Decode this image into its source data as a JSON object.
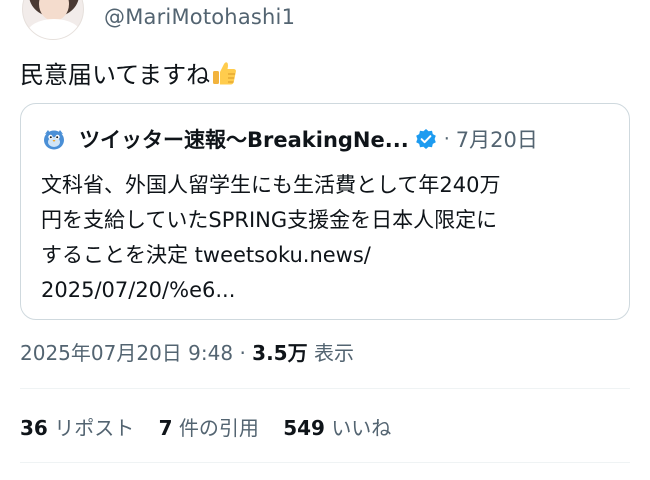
{
  "author": {
    "handle": "@MariMotohashi1"
  },
  "tweet": {
    "text": "民意届いてますね",
    "emoji": "thumbs-up-emoji"
  },
  "quote": {
    "name": "ツイッター速報〜BreakingNe...",
    "separator": "·",
    "date": "7月20日",
    "body_lines": [
      "文科省、外国人留学生にも生活費として年240万",
      "円を支給していたSPRING支援金を日本人限定に",
      "することを決定 tweetsoku.news/",
      "2025/07/20/%e6..."
    ],
    "verified_color": "#1d9bf0",
    "icon": "bird-mascot-icon"
  },
  "meta": {
    "timestamp": "2025年07月20日 9:48",
    "separator": "·",
    "views_count": "3.5万",
    "views_label": "表示"
  },
  "stats": {
    "reposts_count": "36",
    "reposts_label": "リポスト",
    "quotes_count": "7",
    "quotes_label": "件の引用",
    "likes_count": "549",
    "likes_label": "いいね"
  },
  "colors": {
    "text": "#0f1419",
    "secondary": "#536471",
    "border": "#cfd9de",
    "accent": "#1d9bf0"
  }
}
